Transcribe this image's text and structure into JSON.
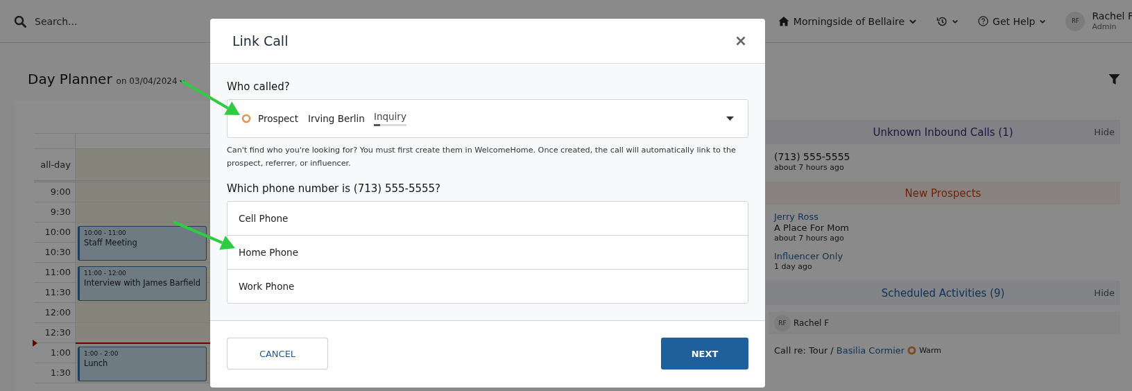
{
  "topbar": {
    "search": {
      "placeholder": "Search..."
    },
    "community": "Morningside of Bellaire",
    "help": "Get Help",
    "user": {
      "initials": "RF",
      "name": "Rachel F",
      "role": "Admin"
    }
  },
  "planner": {
    "title": "Day Planner",
    "date": "on 03/04/2024",
    "allday_label": "all-day",
    "slots": [
      {
        "label": "9:00",
        "now": false
      },
      {
        "label": "9:30",
        "now": false
      },
      {
        "label": "10:00",
        "now": false,
        "event": {
          "time": "10:00 - 11:00",
          "title": "Staff Meeting"
        }
      },
      {
        "label": "10:30",
        "now": false
      },
      {
        "label": "11:00",
        "now": false,
        "event": {
          "time": "11:00 - 12:00",
          "title": "Interview with James Barfield"
        }
      },
      {
        "label": "11:30",
        "now": false
      },
      {
        "label": "12:00",
        "now": false
      },
      {
        "label": "12:30",
        "now": false
      },
      {
        "label": "1:00",
        "now": true,
        "event": {
          "time": "1:00 - 2:00",
          "title": "Lunch"
        }
      },
      {
        "label": "1:30",
        "now": false
      }
    ]
  },
  "panel": [
    {
      "kind": "calls",
      "title": "Unknown Inbound Calls (1)",
      "hide": "Hide",
      "items": [
        {
          "primary": "(713) 555-5555",
          "time": "about 7 hours ago"
        }
      ]
    },
    {
      "kind": "prospects",
      "title": "New Prospects",
      "items": [
        {
          "name": "Jerry Ross",
          "source": "A Place For Mom",
          "time": "about 7 hours ago"
        },
        {
          "name": "Influencer Only",
          "time": "1 day ago"
        }
      ]
    },
    {
      "kind": "activities",
      "title": "Scheduled Activities (9)",
      "hide": "Hide",
      "owner": {
        "initials": "RF",
        "name": "Rachel F"
      },
      "items": [
        {
          "label": "Call re: Tour /",
          "contact": "Basilia Cormier",
          "status": "Warm"
        }
      ]
    }
  ],
  "modal": {
    "title": "Link Call",
    "who_label": "Who called?",
    "contact": {
      "type": "Prospect",
      "name": "Irving Berlin",
      "stage": "Inquiry",
      "level": 0.2
    },
    "help_text": "Can't find who you're looking for? You must first create them in WelcomeHome. Once created, the call will automatically link to the prospect, referrer, or influencer.",
    "phone_question": "Which phone number is (713) 555-5555?",
    "phone_options": [
      {
        "label": "Cell Phone",
        "selected": false
      },
      {
        "label": "Home Phone",
        "selected": false
      },
      {
        "label": "Work Phone",
        "selected": false
      }
    ],
    "buttons": [
      {
        "kind": "secondary",
        "label": "CANCEL"
      },
      {
        "kind": "primary",
        "label": "NEXT"
      }
    ]
  }
}
